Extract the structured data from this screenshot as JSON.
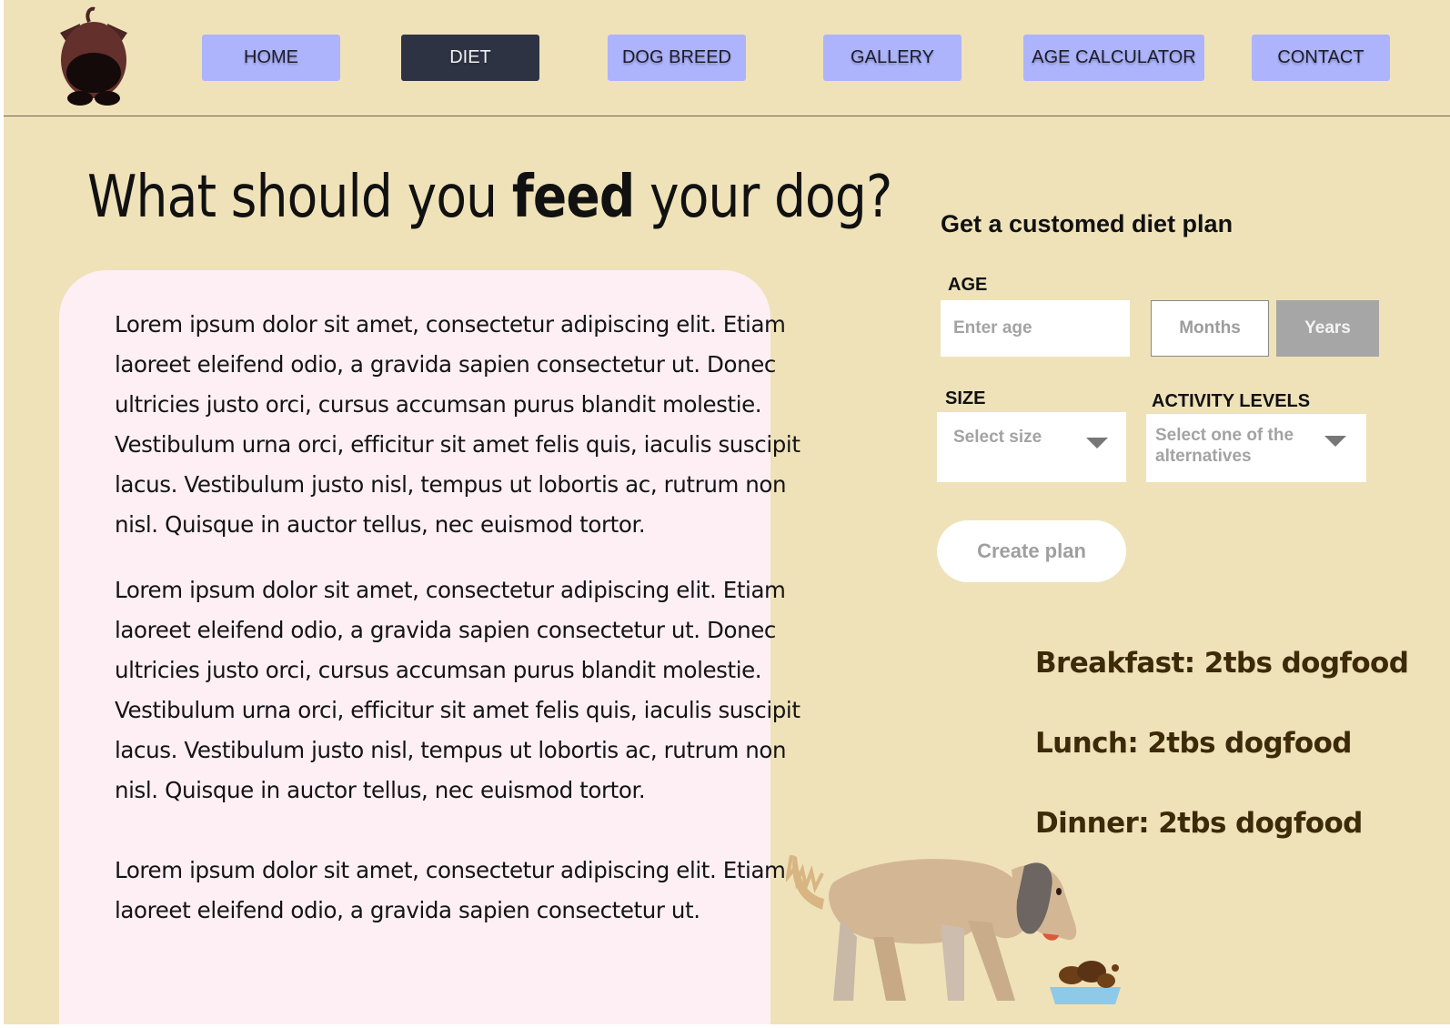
{
  "nav": {
    "items": [
      {
        "label": "HOME",
        "active": false
      },
      {
        "label": "DIET",
        "active": true
      },
      {
        "label": "DOG BREED",
        "active": false
      },
      {
        "label": "GALLERY",
        "active": false
      },
      {
        "label": "AGE CALCULATOR",
        "active": false
      },
      {
        "label": "CONTACT",
        "active": false
      }
    ]
  },
  "hero": {
    "title_before": "What should you ",
    "title_bold": "feed",
    "title_after": " your dog?"
  },
  "article": {
    "paragraphs": [
      "Lorem ipsum dolor sit amet, consectetur adipiscing elit. Etiam laoreet eleifend odio, a gravida sapien consectetur ut. Donec ultricies justo orci, cursus accumsan purus blandit molestie. Vestibulum urna orci, efficitur sit amet felis quis, iaculis suscipit lacus. Vestibulum justo nisl, tempus ut lobortis ac, rutrum non nisl. Quisque in auctor tellus, nec euismod tortor.",
      "Lorem ipsum dolor sit amet, consectetur adipiscing elit. Etiam laoreet eleifend odio, a gravida sapien consectetur ut. Donec ultricies justo orci, cursus accumsan purus blandit molestie. Vestibulum urna orci, efficitur sit amet felis quis, iaculis suscipit lacus. Vestibulum justo nisl, tempus ut lobortis ac, rutrum non nisl. Quisque in auctor tellus, nec euismod tortor.",
      "Lorem ipsum dolor sit amet, consectetur adipiscing elit. Etiam laoreet eleifend odio, a gravida sapien consectetur ut."
    ]
  },
  "diet_form": {
    "title": "Get a customed diet plan",
    "age_label": "AGE",
    "age_placeholder": "Enter age",
    "months_label": "Months",
    "years_label": "Years",
    "size_label": "SIZE",
    "size_placeholder": "Select size",
    "activity_label": "ACTIVITY LEVELS",
    "activity_placeholder": "Select one of the alternatives",
    "submit_label": "Create plan"
  },
  "plan": {
    "breakfast": "Breakfast: 2tbs dogfood",
    "lunch": "Lunch: 2tbs dogfood",
    "dinner": "Dinner: 2tbs dogfood"
  },
  "colors": {
    "background": "#efe2b9",
    "nav_button": "#adb4fb",
    "nav_active": "#2e3344",
    "article_panel": "#fdeff4",
    "meal_text": "#3c2a09"
  }
}
